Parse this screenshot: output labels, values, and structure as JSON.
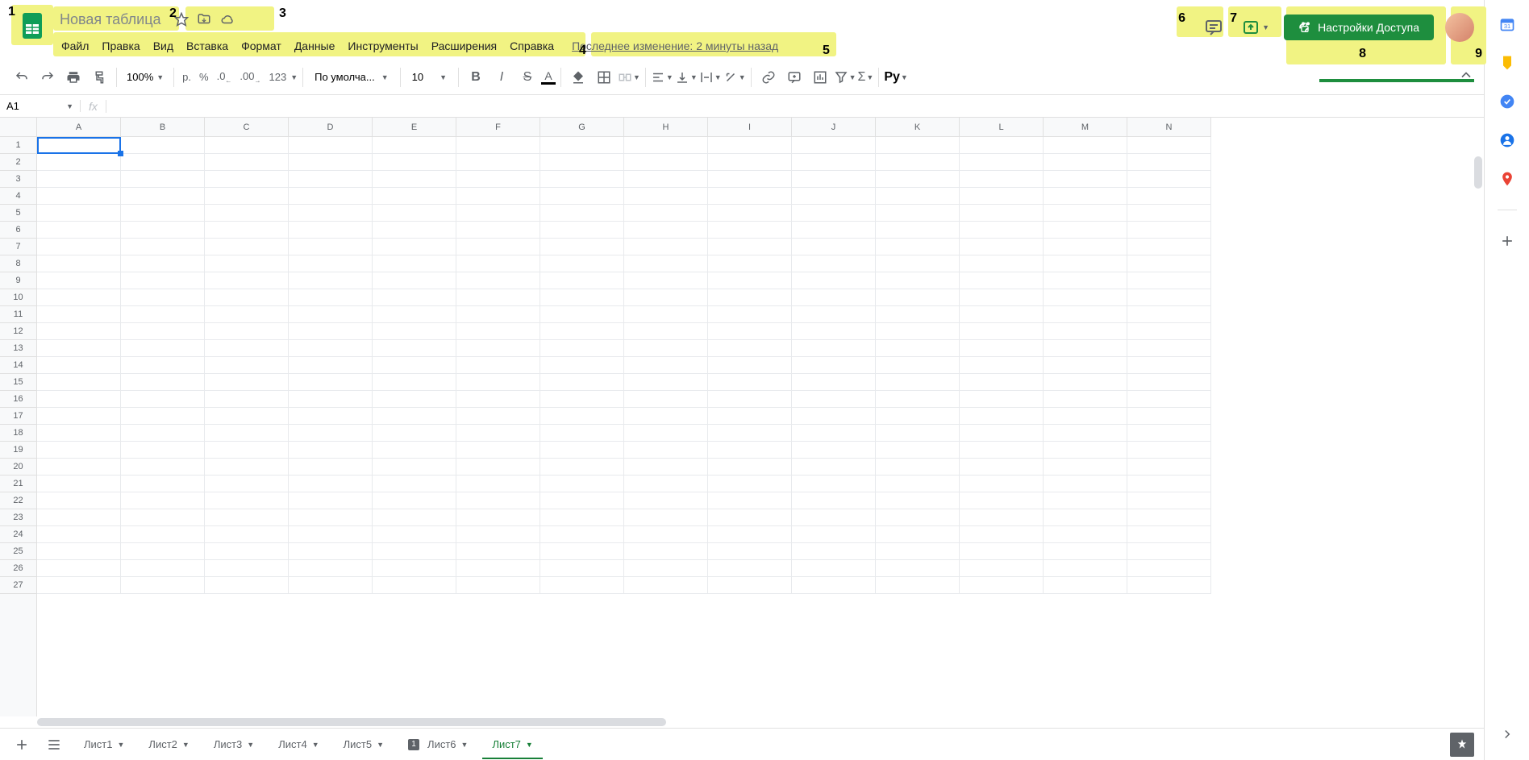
{
  "annotations": [
    "1",
    "2",
    "3",
    "4",
    "5",
    "6",
    "7",
    "8",
    "9"
  ],
  "doc_title": "Новая таблица",
  "menus": [
    "Файл",
    "Правка",
    "Вид",
    "Вставка",
    "Формат",
    "Данные",
    "Инструменты",
    "Расширения",
    "Справка"
  ],
  "last_change": "Последнее изменение: 2 минуты назад",
  "share_label": "Настройки Доступа",
  "toolbar": {
    "zoom": "100%",
    "currency": "р.",
    "percent": "%",
    "dec_dec": ".0",
    "dec_inc": ".00",
    "num_fmt": "123",
    "font": "По умолча...",
    "size": "10",
    "pv": "Рy"
  },
  "name_box": "A1",
  "columns": [
    "A",
    "B",
    "C",
    "D",
    "E",
    "F",
    "G",
    "H",
    "I",
    "J",
    "K",
    "L",
    "M",
    "N"
  ],
  "rows": [
    "1",
    "2",
    "3",
    "4",
    "5",
    "6",
    "7",
    "8",
    "9",
    "10",
    "11",
    "12",
    "13",
    "14",
    "15",
    "16",
    "17",
    "18",
    "19",
    "20",
    "21",
    "22",
    "23",
    "24",
    "25",
    "26",
    "27"
  ],
  "sheets": [
    {
      "label": "Лист1",
      "active": false,
      "badge": null
    },
    {
      "label": "Лист2",
      "active": false,
      "badge": null
    },
    {
      "label": "Лист3",
      "active": false,
      "badge": null
    },
    {
      "label": "Лист4",
      "active": false,
      "badge": null
    },
    {
      "label": "Лист5",
      "active": false,
      "badge": null
    },
    {
      "label": "Лист6",
      "active": false,
      "badge": "1"
    },
    {
      "label": "Лист7",
      "active": true,
      "badge": null
    }
  ]
}
